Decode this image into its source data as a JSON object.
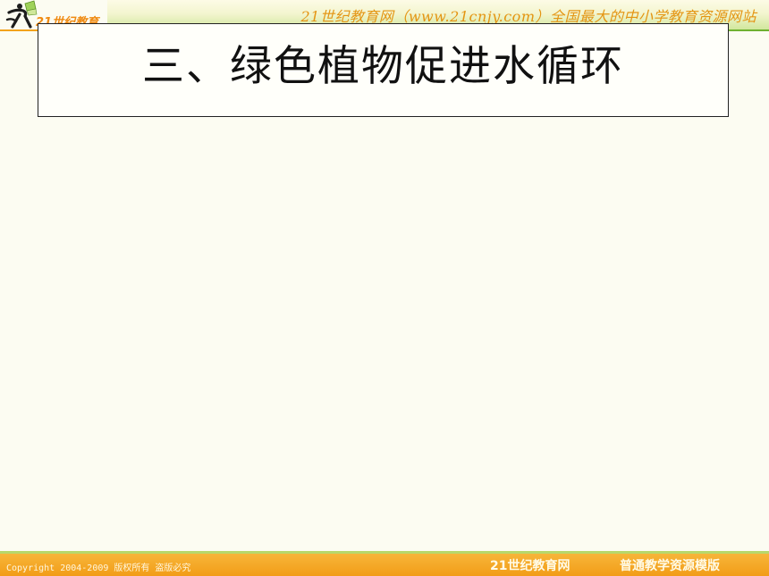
{
  "header": {
    "logo_text": "21世纪教育",
    "slogan": "21世纪教育网（www.21cnjy.com）全国最大的中小学教育资源网站",
    "accent_orange": "#f2a21c",
    "accent_green": "#8cc43a"
  },
  "slide": {
    "title": "三、绿色植物促进水循环"
  },
  "footer": {
    "copyright": "Copyright 2004-2009 版权所有 盗版必究",
    "site_name": "21世纪教育网",
    "template_name": "普通教学资源模版"
  }
}
